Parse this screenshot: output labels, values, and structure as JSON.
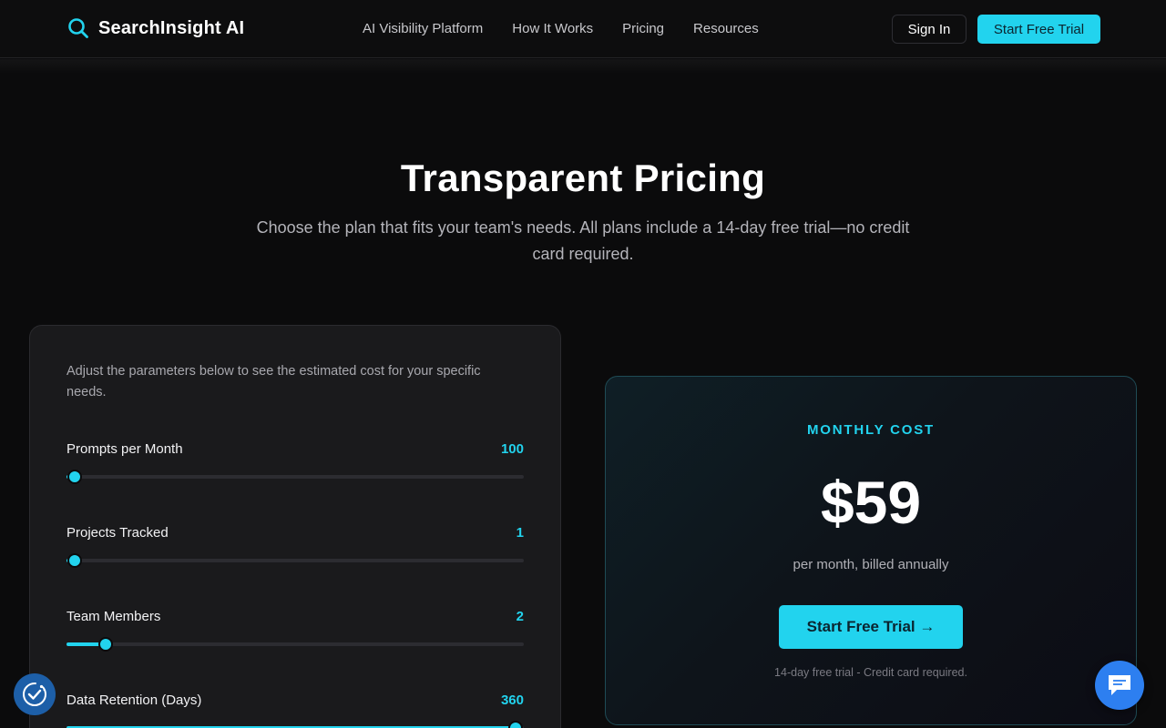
{
  "header": {
    "brand_name": "SearchInsight AI",
    "nav": [
      "AI Visibility Platform",
      "How It Works",
      "Pricing",
      "Resources"
    ],
    "sign_in_label": "Sign In",
    "trial_label": "Start Free Trial"
  },
  "hero": {
    "title": "Transparent Pricing",
    "subtitle": "Choose the plan that fits your team's needs. All plans include a 14-day free trial—no credit card required."
  },
  "calculator": {
    "description": "Adjust the parameters below to see the estimated cost for your specific needs.",
    "params": [
      {
        "label": "Prompts per Month",
        "value": "100",
        "fraction": 0.0
      },
      {
        "label": "Projects Tracked",
        "value": "1",
        "fraction": 0.0
      },
      {
        "label": "Team Members",
        "value": "2",
        "fraction": 0.07
      },
      {
        "label": "Data Retention (Days)",
        "value": "360",
        "fraction": 1.0
      }
    ]
  },
  "cost": {
    "label": "MONTHLY COST",
    "amount": "$59",
    "billing": "per month, billed annually",
    "cta_label": "Start Free Trial →",
    "note": "14-day free trial - Credit card required."
  },
  "colors": {
    "accent": "#22d3ee",
    "background": "#0b0b0c",
    "card": "#1a1a1c",
    "chat": "#2d7ff0",
    "consent": "#1d5fa8"
  },
  "icons": {
    "logo": "search-icon",
    "consent": "cookie-consent-icon",
    "chat": "chat-bubble-icon"
  }
}
